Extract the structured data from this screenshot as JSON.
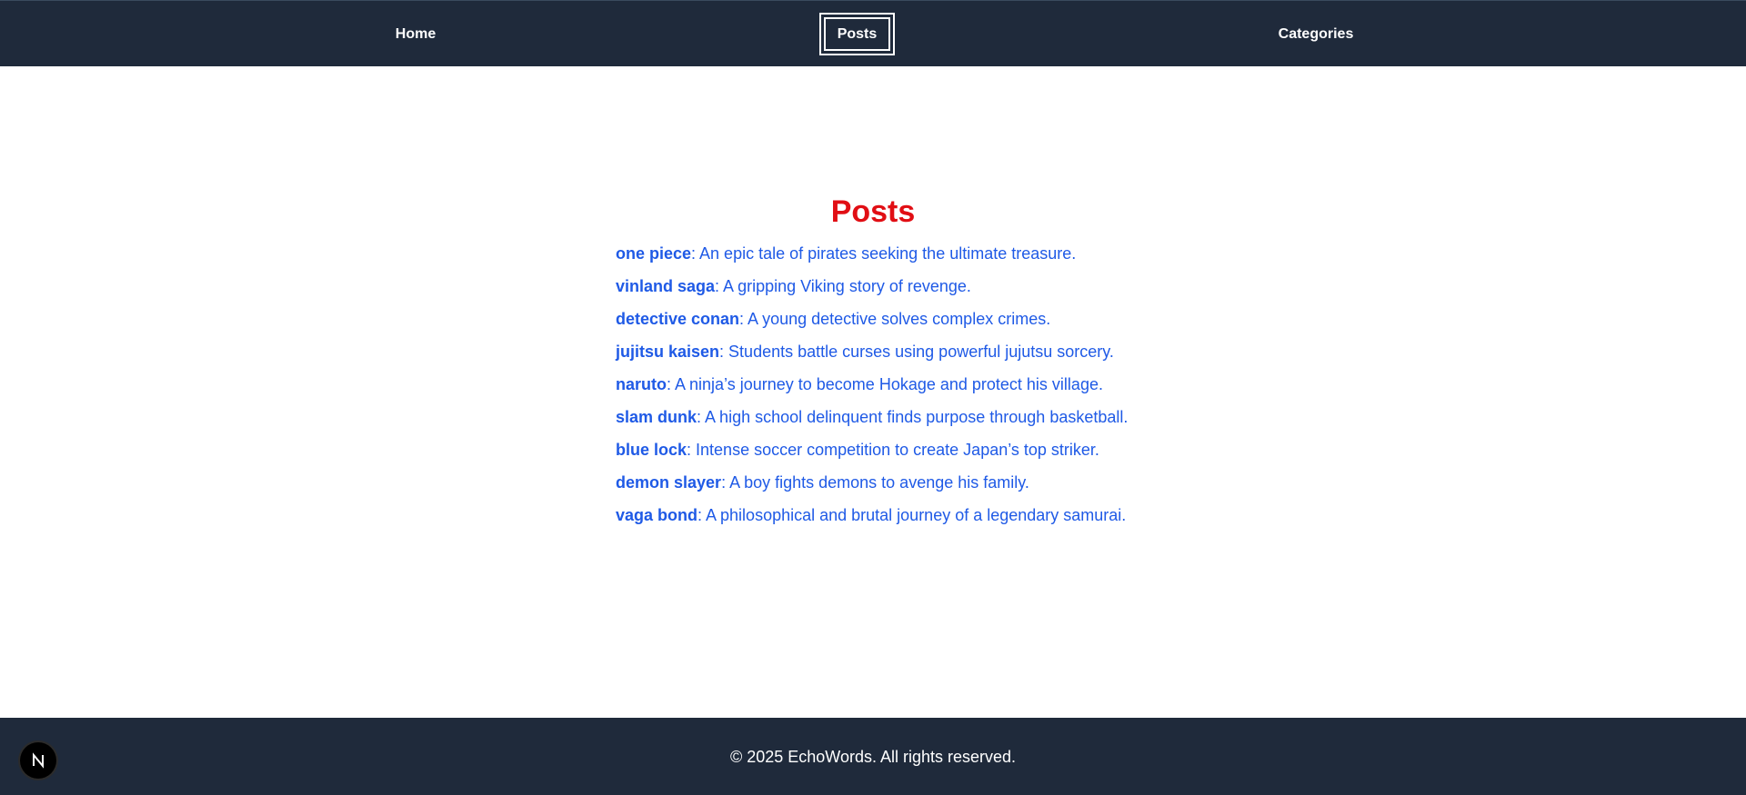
{
  "nav": {
    "items": [
      {
        "label": "Home"
      },
      {
        "label": "Posts",
        "active": true
      },
      {
        "label": "Categories"
      }
    ]
  },
  "main": {
    "title": "Posts",
    "posts": [
      {
        "title": "one piece",
        "description": ": An epic tale of pirates seeking the ultimate treasure."
      },
      {
        "title": "vinland saga",
        "description": ": A gripping Viking story of revenge."
      },
      {
        "title": "detective conan",
        "description": ": A young detective solves complex crimes."
      },
      {
        "title": "jujitsu kaisen",
        "description": ": Students battle curses using powerful jujutsu sorcery."
      },
      {
        "title": "naruto",
        "description": ": A ninja’s journey to become Hokage and protect his village."
      },
      {
        "title": "slam dunk",
        "description": ": A high school delinquent finds purpose through basketball."
      },
      {
        "title": "blue lock",
        "description": ": Intense soccer competition to create Japan’s top striker."
      },
      {
        "title": "demon slayer",
        "description": ": A boy fights demons to avenge his family."
      },
      {
        "title": "vaga bond",
        "description": ": A philosophical and brutal journey of a legendary samurai."
      }
    ]
  },
  "footer": {
    "text": "© 2025 EchoWords. All rights reserved.",
    "badge_icon": "nextjs-logo-icon",
    "badge_letter": "N"
  },
  "colors": {
    "nav_bg": "#1f2a3b",
    "title": "#e10e14",
    "link": "#1f5ae6"
  }
}
